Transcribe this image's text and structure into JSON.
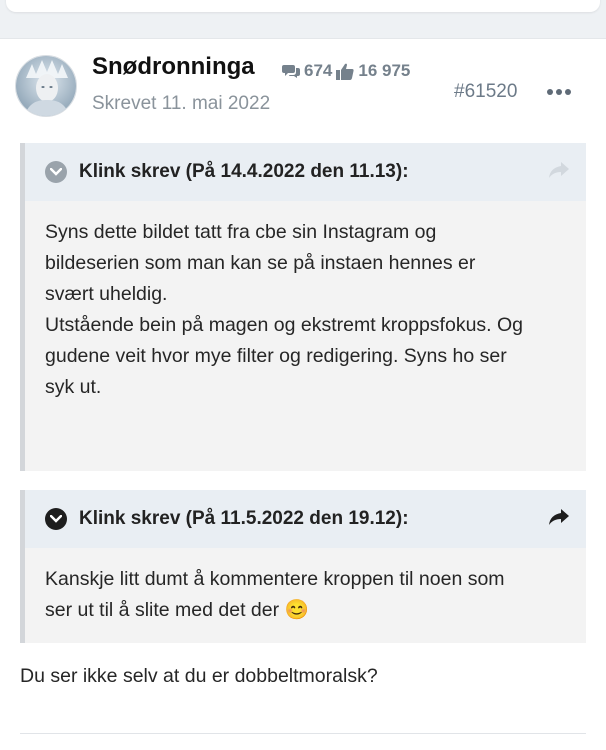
{
  "post": {
    "author": "Snødronninga",
    "comments_count": "674",
    "likes_count": "16 975",
    "date": "Skrevet 11. mai 2022",
    "post_number": "#61520"
  },
  "quotes": [
    {
      "header": "Klink skrev (På 14.4.2022 den 11.13):",
      "lines": [
        "Syns dette bildet tatt fra cbe sin Instagram og",
        "bildeserien som man kan se på instaen hennes er",
        "svært uheldig.",
        "Utstående bein på magen og ekstremt kroppsfokus. Og",
        "gudene veit hvor mye filter og redigering. Syns ho ser",
        "syk ut."
      ]
    },
    {
      "header": "Klink skrev (På 11.5.2022 den 19.12):",
      "lines": [
        "Kanskje litt dumt å kommentere kroppen til noen som",
        "ser ut til å slite med det der 😊"
      ]
    }
  ],
  "reply_text": "Du ser ikke selv at du er dobbeltmoralsk?",
  "icons": {
    "comments": "comment-bubbles-icon",
    "likes": "thumbs-up-icon",
    "toggle": "chevron-down-circle-icon",
    "share": "share-arrow-icon",
    "more": "more-dots-icon"
  },
  "colors": {
    "quote_header_bg": "#e9eef3",
    "quote_body_bg": "#f3f3f3",
    "muted_text": "#8a939b",
    "icon_dark": "#1e1e1e",
    "icon_muted": "#9aa3ab"
  }
}
